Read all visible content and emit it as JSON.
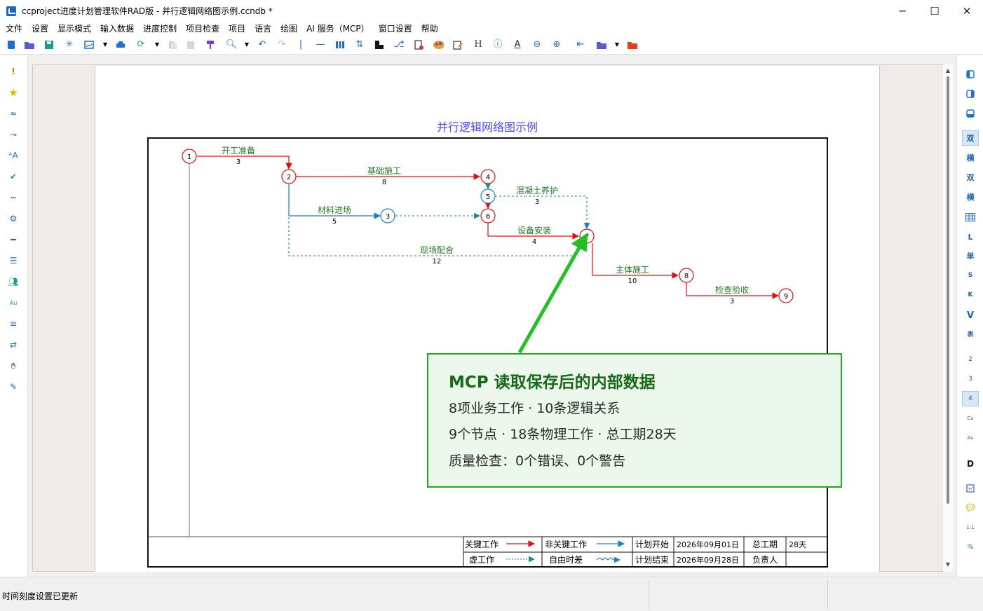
{
  "window": {
    "title": "ccproject进度计划管理软件RAD版 - 并行逻辑网络图示例.ccndb *",
    "minimize": "─",
    "maximize": "☐",
    "close": "✕"
  },
  "menu": [
    "文件",
    "设置",
    "显示模式",
    "输入数据",
    "进度控制",
    "项目检查",
    "项目",
    "语言",
    "绘图",
    "AI 服务（MCP）",
    "窗口设置",
    "帮助"
  ],
  "toolbar": {
    "text_tool_H": "H",
    "text_tool_A": "A"
  },
  "right_toolbar": [
    "双",
    "横",
    "双",
    "横",
    "L",
    "单",
    "S",
    "K",
    "V",
    "表",
    "2",
    "3",
    "4",
    "Cu",
    "Au",
    "D",
    "1:1",
    "%"
  ],
  "left_toolbar": {
    "au_label": "Au"
  },
  "diagram": {
    "title": "并行逻辑网络图示例",
    "nodes": [
      "1",
      "2",
      "3",
      "4",
      "5",
      "6",
      "7",
      "8",
      "9"
    ],
    "works": [
      {
        "name": "开工准备",
        "duration": "3"
      },
      {
        "name": "基础施工",
        "duration": "8"
      },
      {
        "name": "材料进场",
        "duration": "5"
      },
      {
        "name": "混凝土养护",
        "duration": "3"
      },
      {
        "name": "设备安装",
        "duration": "4"
      },
      {
        "name": "现场配合",
        "duration": "12"
      },
      {
        "name": "主体施工",
        "duration": "10"
      },
      {
        "name": "检查验收",
        "duration": "3"
      }
    ],
    "colors": {
      "critical": "#e01010",
      "noncritical": "#1a7fd4",
      "dummy": "#1a8a8a",
      "label": "#1f7a1f",
      "title": "#4a4aff"
    },
    "legend": {
      "critical_label": "关键工作",
      "noncritical_label": "非关键工作",
      "dummy_label": "虚工作",
      "float_label": "自由时差",
      "plan_start_label": "计划开始",
      "plan_start_value": "2026年09月01日",
      "plan_end_label": "计划结束",
      "plan_end_value": "2026年09月28日",
      "total_duration_label": "总工期",
      "total_duration_value": "28天",
      "owner_label": "负责人"
    }
  },
  "callout": {
    "title": "MCP 读取保存后的内部数据",
    "line1": "8项业务工作 · 10条逻辑关系",
    "line2": "9个节点 · 18条物理工作 · 总工期28天",
    "line3": "质量检查：0个错误、0个警告",
    "accent": "#22a822"
  },
  "status": {
    "text": "时间刻度设置已更新"
  }
}
